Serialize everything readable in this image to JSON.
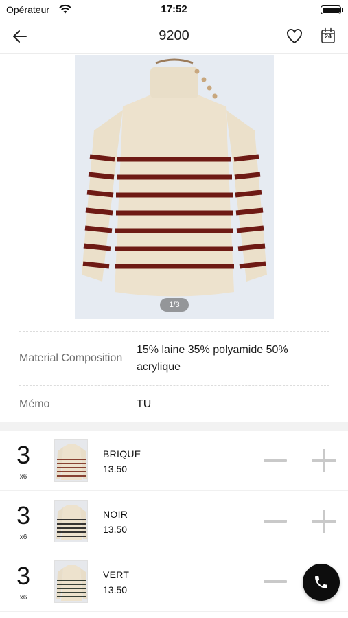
{
  "status_bar": {
    "carrier": "Opérateur",
    "time": "17:52"
  },
  "nav": {
    "title": "9200",
    "calendar_day": "24"
  },
  "product": {
    "image_counter": "1/3",
    "stripe_color": "#6e1a14",
    "knit_color": "#ece1cc"
  },
  "details": [
    {
      "label": "Material Composition",
      "value": "15% laine 35% polyamide 50% acrylique"
    },
    {
      "label": "Mémo",
      "value": "TU"
    }
  ],
  "variants": [
    {
      "qty": "3",
      "mult": "x6",
      "name": "BRIQUE",
      "price": "13.50",
      "stripe_color": "#7a2b1c"
    },
    {
      "qty": "3",
      "mult": "x6",
      "name": "NOIR",
      "price": "13.50",
      "stripe_color": "#1c1c1c"
    },
    {
      "qty": "3",
      "mult": "x6",
      "name": "VERT",
      "price": "13.50",
      "stripe_color": "#1f2a22"
    }
  ],
  "icons": {
    "back": "back-arrow-icon",
    "favorite": "heart-icon",
    "calendar": "calendar-icon",
    "call": "phone-icon"
  }
}
